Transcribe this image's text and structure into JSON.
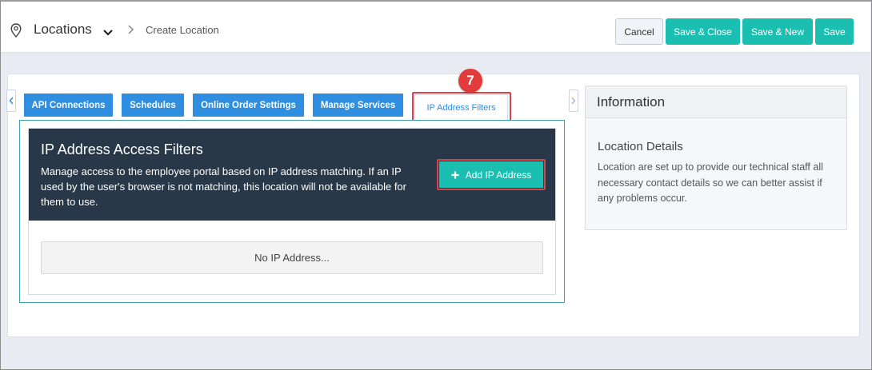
{
  "header": {
    "breadcrumb_root": "Locations",
    "breadcrumb_current": "Create Location",
    "icons": {
      "location": "map-pin-icon",
      "dropdown": "chevron-down-icon",
      "separator": "chevron-right-icon"
    },
    "buttons": {
      "cancel": "Cancel",
      "save_close": "Save & Close",
      "save_new": "Save & New",
      "save": "Save"
    }
  },
  "tabs": [
    {
      "label": "API Connections"
    },
    {
      "label": "Schedules"
    },
    {
      "label": "Online Order Settings"
    },
    {
      "label": "Manage Services"
    },
    {
      "label": "IP Address Filters",
      "active": true
    }
  ],
  "callout_step": "7",
  "ip_filters": {
    "title": "IP Address Access Filters",
    "description": "Manage access to the employee portal based on IP address matching. If an IP used by the user's browser is not matching, this location will not be available for them to use.",
    "add_button": "Add IP Address",
    "add_icon": "plus-icon",
    "empty_text": "No IP Address..."
  },
  "info": {
    "title": "Information",
    "subtitle": "Location Details",
    "description": "Location are set up to provide our technical staff all necessary contact details so we can better assist if any problems occur."
  },
  "colors": {
    "accent_teal": "#1bbfb1",
    "tab_blue": "#2f8ee0",
    "panel_dark": "#283848",
    "callout_red": "#e23b3b"
  }
}
